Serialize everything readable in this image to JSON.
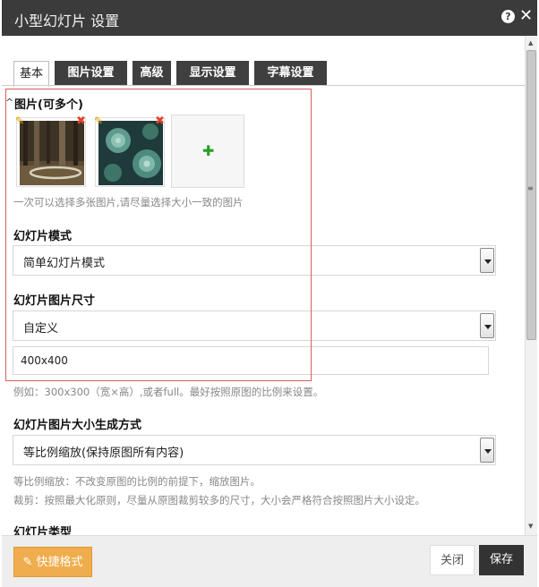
{
  "window": {
    "title": "小型幻灯片 设置",
    "help_label": "?",
    "close_label": "✕"
  },
  "tabs": [
    {
      "label": "基本",
      "active": true
    },
    {
      "label": "图片设置",
      "active": false
    },
    {
      "label": "高级",
      "active": false
    },
    {
      "label": "显示设置",
      "active": false
    },
    {
      "label": "字幕设置",
      "active": false
    }
  ],
  "images_section": {
    "collapse_icon": "^",
    "title": "图片(可多个)",
    "add_icon": "✚",
    "hint": "一次可以选择多张图片,请尽量选择大小一致的图片",
    "edit_icon": "✎",
    "delete_icon": "✖"
  },
  "mode": {
    "label": "幻灯片模式",
    "value": "简单幻灯片模式"
  },
  "size": {
    "label": "幻灯片图片尺寸",
    "value": "自定义",
    "custom_value": "400x400",
    "hint": "例如：300x300（宽×高）,或者full。最好按照原图的比例来设置。"
  },
  "generation": {
    "label": "幻灯片图片大小生成方式",
    "value": "等比例缩放(保持原图所有内容)",
    "hint1": "等比例缩放：不改变原图的比例的前提下，缩放图片。",
    "hint2": "裁剪：按照最大化原则，尽量从原图裁剪较多的尺寸，大小会严格符合按照图片大小设定。"
  },
  "type": {
    "label": "幻灯片类型"
  },
  "footer": {
    "quick_label": "快捷格式",
    "quick_icon": "✎",
    "cancel_label": "关闭",
    "save_label": "保存"
  },
  "scrollbar": {
    "up": "▲",
    "down": "▼",
    "grip": "≡"
  },
  "colors": {
    "titlebar": "#3b3b3b",
    "accent_orange": "#f0ad4e",
    "save": "#333333",
    "highlight": "#e05a5a"
  }
}
